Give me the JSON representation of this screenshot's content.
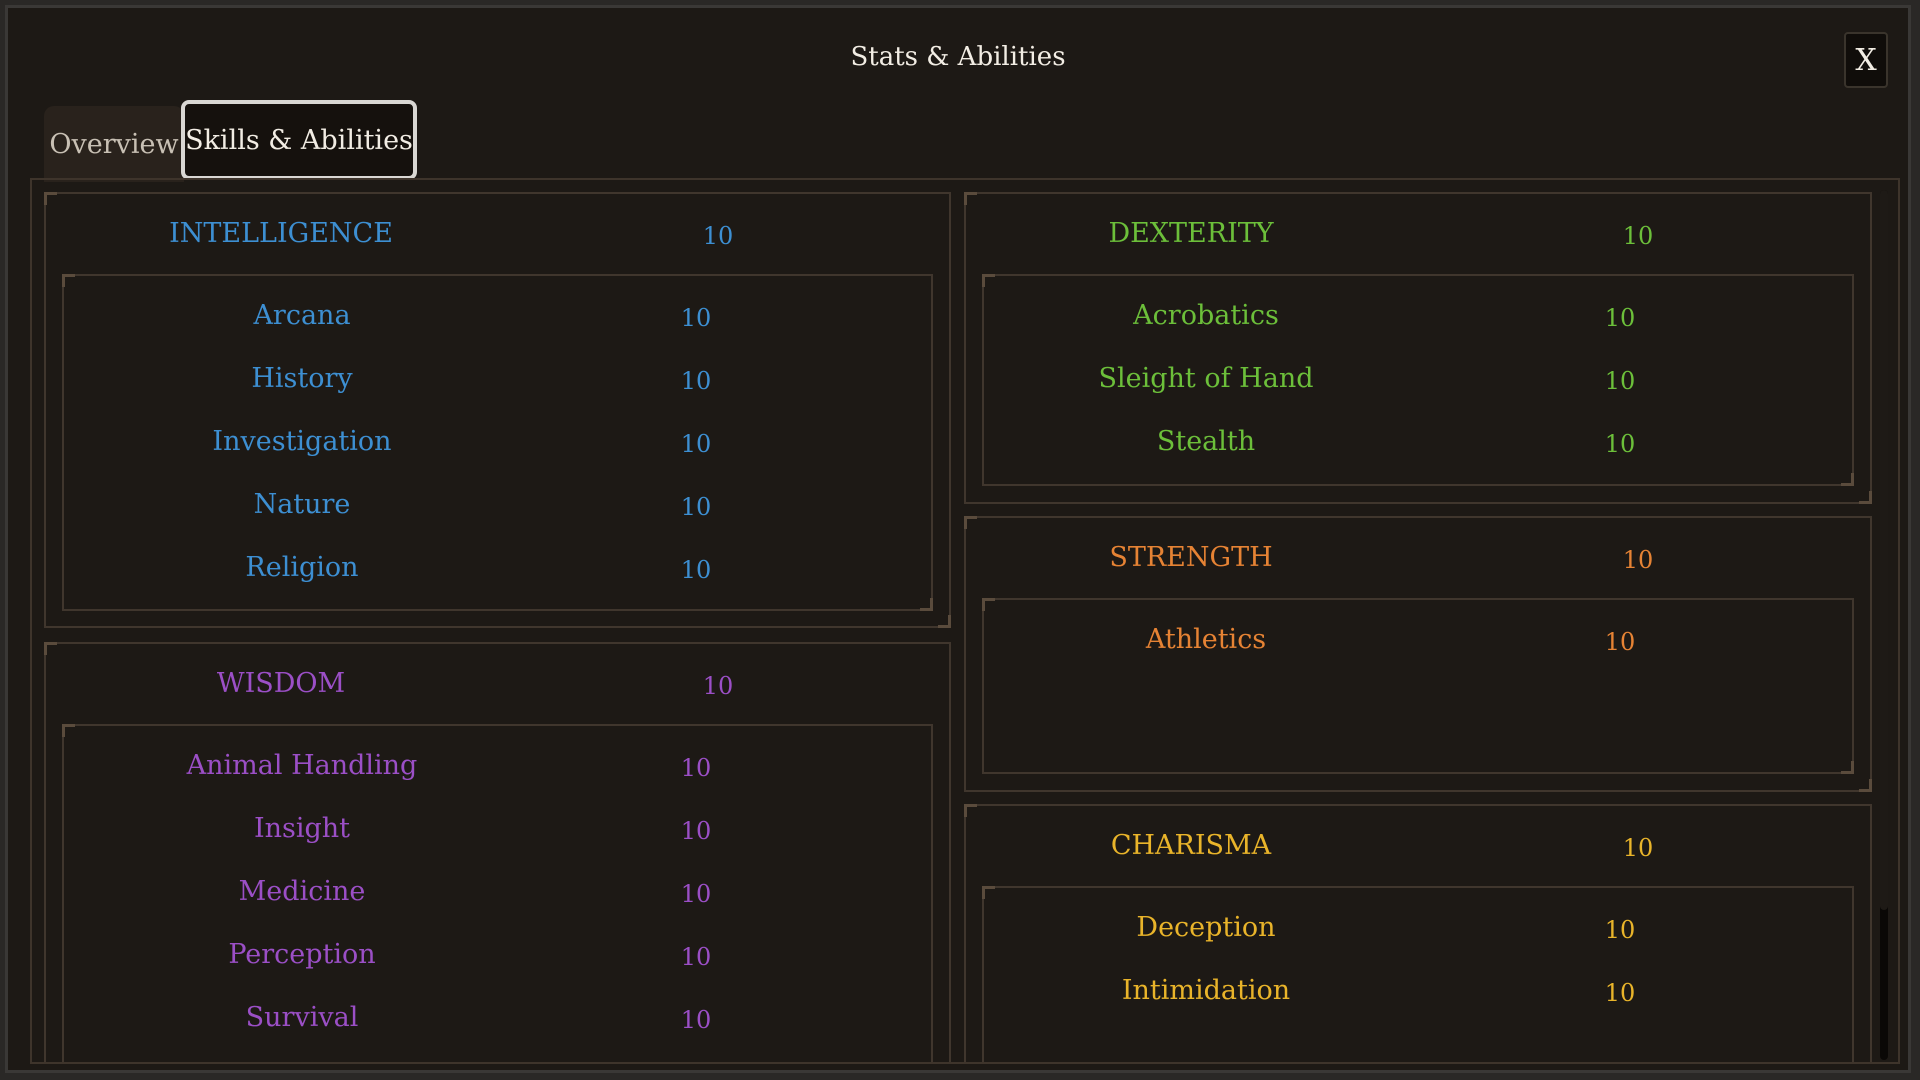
{
  "window": {
    "title": "Stats & Abilities",
    "close_label": "X"
  },
  "tabs": [
    {
      "label": "Overview",
      "active": false
    },
    {
      "label": "Skills & Abilities",
      "active": true
    }
  ],
  "colors": {
    "intelligence": "#3d8fd2",
    "wisdom": "#9b4fc6",
    "dexterity": "#6cbf3a",
    "strength": "#e68334",
    "charisma": "#e9b42a"
  },
  "stats": {
    "intelligence": {
      "name": "INTELLIGENCE",
      "value": "10",
      "skills": [
        {
          "name": "Arcana",
          "value": "10"
        },
        {
          "name": "History",
          "value": "10"
        },
        {
          "name": "Investigation",
          "value": "10"
        },
        {
          "name": "Nature",
          "value": "10"
        },
        {
          "name": "Religion",
          "value": "10"
        }
      ]
    },
    "wisdom": {
      "name": "WISDOM",
      "value": "10",
      "skills": [
        {
          "name": "Animal Handling",
          "value": "10"
        },
        {
          "name": "Insight",
          "value": "10"
        },
        {
          "name": "Medicine",
          "value": "10"
        },
        {
          "name": "Perception",
          "value": "10"
        },
        {
          "name": "Survival",
          "value": "10"
        }
      ]
    },
    "dexterity": {
      "name": "DEXTERITY",
      "value": "10",
      "skills": [
        {
          "name": "Acrobatics",
          "value": "10"
        },
        {
          "name": "Sleight of Hand",
          "value": "10"
        },
        {
          "name": "Stealth",
          "value": "10"
        }
      ]
    },
    "strength": {
      "name": "STRENGTH",
      "value": "10",
      "skills": [
        {
          "name": "Athletics",
          "value": "10"
        }
      ]
    },
    "charisma": {
      "name": "CHARISMA",
      "value": "10",
      "skills": [
        {
          "name": "Deception",
          "value": "10"
        },
        {
          "name": "Intimidation",
          "value": "10"
        }
      ]
    }
  }
}
